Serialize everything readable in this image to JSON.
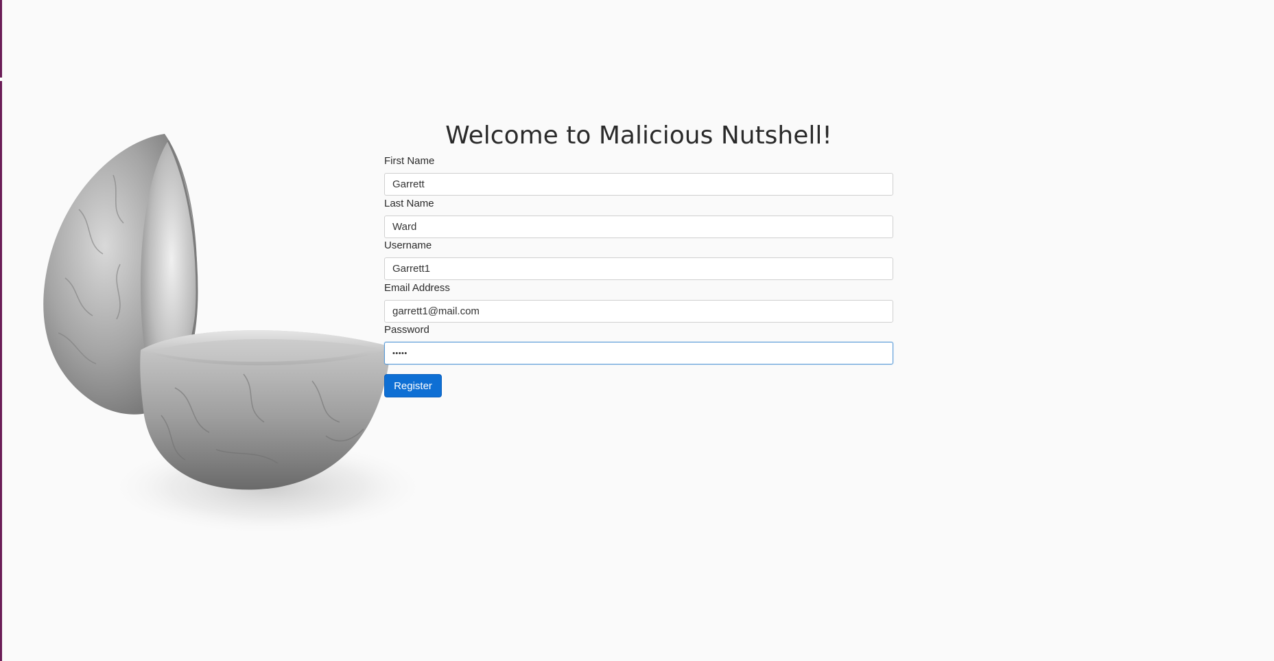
{
  "page": {
    "title": "Welcome to Malicious Nutshell!"
  },
  "form": {
    "first_name": {
      "label": "First Name",
      "value": "Garrett"
    },
    "last_name": {
      "label": "Last Name",
      "value": "Ward"
    },
    "username": {
      "label": "Username",
      "value": "Garrett1"
    },
    "email": {
      "label": "Email Address",
      "value": "garrett1@mail.com"
    },
    "password": {
      "label": "Password",
      "value": "•••••"
    },
    "submit_label": "Register"
  },
  "illustration": {
    "icon": "open-nutshell-image"
  },
  "colors": {
    "background": "#fafafa",
    "accent": "#0e6fd4",
    "focus_border": "#5a9bd8",
    "left_edge": "#6b1d57"
  }
}
